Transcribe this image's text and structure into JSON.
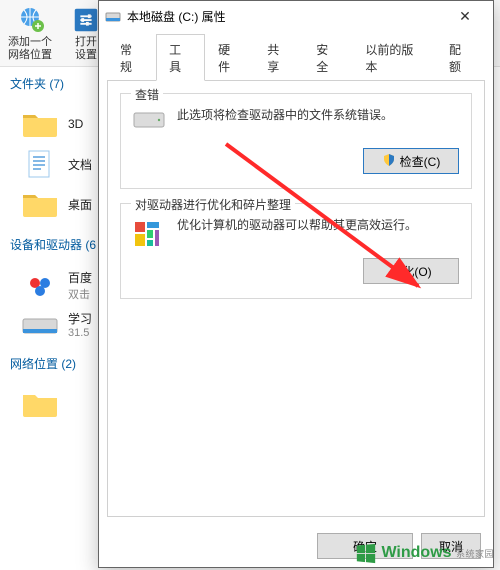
{
  "explorer": {
    "toolbar": [
      {
        "label": "添加一个\n网络位置"
      },
      {
        "label": "打开\n设置"
      }
    ],
    "folders_header": "文件夹 (7)",
    "folders": [
      {
        "label": "3D"
      },
      {
        "label": "文档"
      },
      {
        "label": "桌面"
      }
    ],
    "drives_header": "设备和驱动器 (6",
    "drives": [
      {
        "label": "百度",
        "sub": "双击"
      },
      {
        "label": "学习",
        "sub": "31.5"
      }
    ],
    "network_header": "网络位置 (2)"
  },
  "dialog": {
    "title": "本地磁盘 (C:) 属性",
    "tabs": [
      "常规",
      "工具",
      "硬件",
      "共享",
      "安全",
      "以前的版本",
      "配额"
    ],
    "active_tab": 1,
    "check": {
      "title": "查错",
      "text": "此选项将检查驱动器中的文件系统错误。",
      "button": "检查(C)"
    },
    "optimize": {
      "title": "对驱动器进行优化和碎片整理",
      "text": "优化计算机的驱动器可以帮助其更高效运行。",
      "button": "优化(O)"
    },
    "buttons": {
      "ok": "确定",
      "cancel": "取消"
    }
  },
  "watermark": {
    "brand": "indows",
    "sub": "系统家园"
  }
}
